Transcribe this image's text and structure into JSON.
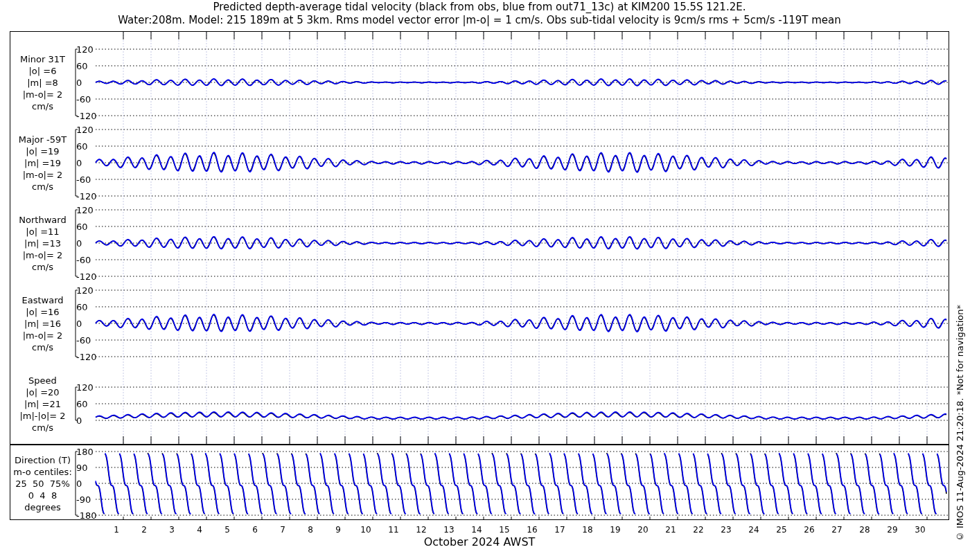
{
  "title": [
    "Predicted depth-average tidal velocity (black from obs, blue from out71_13c) at KIM200 15.5S 121.2E.",
    "Water:208m. Model: 215 189m at 5 3km. Rms model vector error |m-o| = 1 cm/s. Obs sub-tidal velocity is 9cm/s rms + 5cm/s -119T mean"
  ],
  "panels": [
    {
      "kind": "velocity",
      "label": [
        "Minor 31T",
        "|o| =6",
        "|m| =8",
        "|m-o|= 2",
        "cm/s"
      ],
      "yticks": [
        "120",
        "60",
        "0",
        "-60",
        "-120"
      ]
    },
    {
      "kind": "velocity",
      "label": [
        "Major -59T",
        "|o| =19",
        "|m| =19",
        "|m-o|= 2",
        "cm/s"
      ],
      "yticks": [
        "120",
        "60",
        "0",
        "-60",
        "-120"
      ]
    },
    {
      "kind": "velocity",
      "label": [
        "Northward",
        "|o| =11",
        "|m| =13",
        "|m-o|= 2",
        "cm/s"
      ],
      "yticks": [
        "120",
        "60",
        "0",
        "-60",
        "-120"
      ]
    },
    {
      "kind": "velocity",
      "label": [
        "Eastward",
        "|o| =16",
        "|m| =16",
        "|m-o|= 2",
        "cm/s"
      ],
      "yticks": [
        "120",
        "60",
        "0",
        "-60",
        "-120"
      ]
    },
    {
      "kind": "speed",
      "label": [
        "Speed",
        "|o| =20",
        "|m| =21",
        "|m|-|o|= 2",
        "cm/s"
      ],
      "yticks": [
        "120",
        "60",
        "0"
      ]
    },
    {
      "kind": "direction",
      "label": [
        "Direction (T)",
        "m-o centiles:",
        "25  50  75%",
        "0  4  8",
        "degrees"
      ],
      "yticks": [
        "180",
        "90",
        "0",
        "-90",
        "-180"
      ]
    }
  ],
  "xticks": [
    "1",
    "2",
    "3",
    "4",
    "5",
    "6",
    "7",
    "8",
    "9",
    "10",
    "11",
    "12",
    "13",
    "14",
    "15",
    "16",
    "17",
    "18",
    "19",
    "20",
    "21",
    "22",
    "23",
    "24",
    "25",
    "26",
    "27",
    "28",
    "29",
    "30"
  ],
  "xlabel": "October 2024 AWST",
  "credit": "© IMOS 11-Aug-2024 21:20:18. *Not for navigation*"
}
